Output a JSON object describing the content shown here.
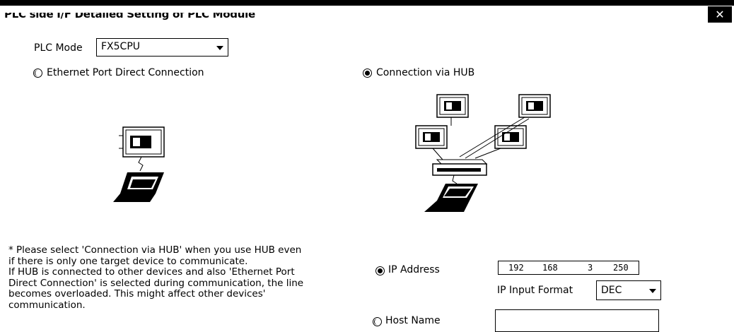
{
  "window": {
    "title": "PLC side I/F Detailed Setting of PLC Module",
    "close_label": "✕"
  },
  "plc_mode": {
    "label": "PLC Mode",
    "value": "FX5CPU"
  },
  "connection": {
    "direct_label": "Ethernet Port Direct Connection",
    "hub_label": "Connection via HUB",
    "selected": "hub"
  },
  "note": {
    "lines": [
      "* Please select 'Connection via HUB' when you use HUB even",
      "if there is only one target device to communicate.",
      "If HUB is connected to other devices and also 'Ethernet Port",
      "Direct Connection' is selected during communication, the line",
      "becomes overloaded. This might affect other devices'",
      "communication."
    ]
  },
  "ip": {
    "label": "IP Address",
    "octets": [
      "192",
      "168",
      "3",
      "250"
    ],
    "format_label": "IP Input Format",
    "format_value": "DEC"
  },
  "host": {
    "label": "Host Name",
    "value": ""
  },
  "icons": {
    "plc": "plc-module-icon",
    "laptop": "laptop-icon",
    "hub": "hub-icon"
  }
}
